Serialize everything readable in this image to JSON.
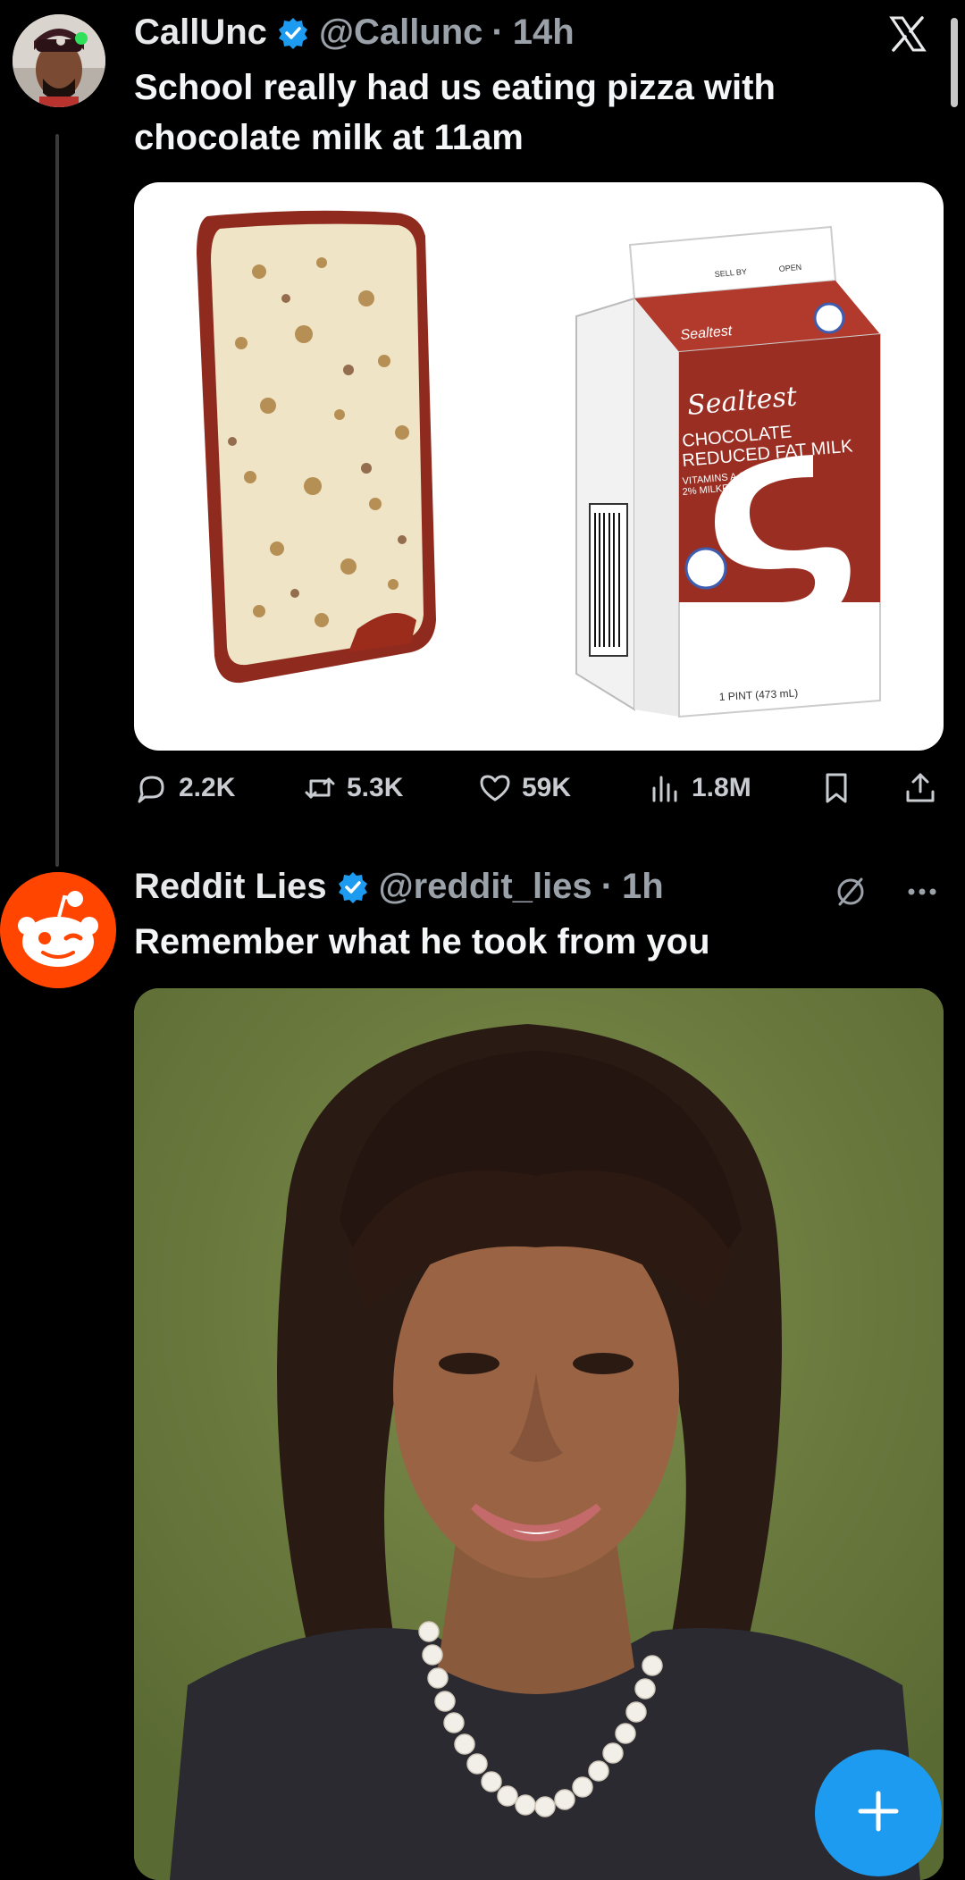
{
  "tweets": [
    {
      "display_name": "CallUnc",
      "handle": "@Callunc",
      "time": "14h",
      "text": "School really had us eating pizza with chocolate milk at 11am",
      "carton": {
        "brand": "Sealtest",
        "product_line1": "CHOCOLATE",
        "product_line2": "REDUCED FAT MILK",
        "vitamins": "VITAMINS A & D",
        "milkfat": "2% MILKFAT",
        "size": "1 PINT (473 mL)",
        "sell_by": "SELL BY",
        "open": "OPEN"
      },
      "actions": {
        "replies": "2.2K",
        "reposts": "5.3K",
        "likes": "59K",
        "views": "1.8M"
      }
    },
    {
      "display_name": "Reddit Lies",
      "handle": "@reddit_lies",
      "time": "1h",
      "text": "Remember what he took from you"
    }
  ],
  "icons": {
    "app_logo": "x-logo-icon",
    "verified": "verified-badge-icon",
    "reply": "reply-icon",
    "repost": "repost-icon",
    "like": "heart-icon",
    "views": "views-chart-icon",
    "bookmark": "bookmark-icon",
    "share": "share-icon",
    "grok": "grok-icon",
    "more": "more-dots-icon",
    "compose": "plus-icon"
  },
  "colors": {
    "background": "#000000",
    "accent": "#1d9bf0",
    "reddit_orange": "#ff4500",
    "text_secondary": "#9aa1a8"
  }
}
